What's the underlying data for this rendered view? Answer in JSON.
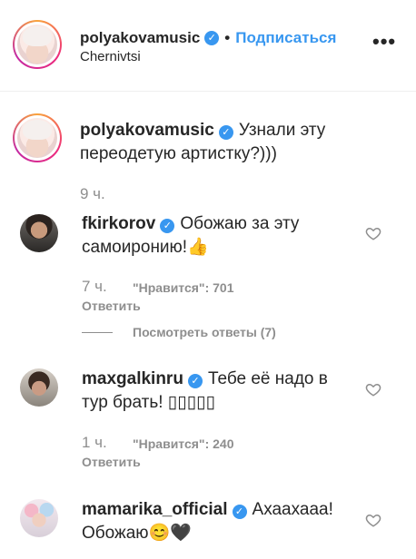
{
  "header": {
    "username": "polyakovamusic",
    "separator": "•",
    "follow_label": "Подписаться",
    "location": "Chernivtsi",
    "more_label": "•••"
  },
  "verified_mark": "✓",
  "caption": {
    "username": "polyakovamusic",
    "text": "Узнали эту переодетую артистку?)))",
    "time": "9 ч."
  },
  "comments": [
    {
      "username": "fkirkorov",
      "text": "Обожаю за эту самоиронию!👍",
      "time": "7 ч.",
      "likes": "\"Нравится\": 701",
      "reply_label": "Ответить"
    },
    {
      "username": "maxgalkinru",
      "text": "Тебе её надо в тур брать! ▯▯▯▯▯",
      "time": "1 ч.",
      "likes": "\"Нравится\": 240",
      "reply_label": "Ответить"
    },
    {
      "username": "mamarika_official",
      "text": "Ахаахааа! Обожаю😊🖤",
      "time": "",
      "likes": "",
      "reply_label": ""
    }
  ],
  "view_replies": "Посмотреть ответы (7)",
  "icons": {
    "heart": "heart-outline-icon",
    "verified": "verified-badge-icon",
    "more": "more-options-icon"
  },
  "colors": {
    "link": "#3897f0",
    "muted": "#8e8e8e",
    "text": "#262626"
  }
}
